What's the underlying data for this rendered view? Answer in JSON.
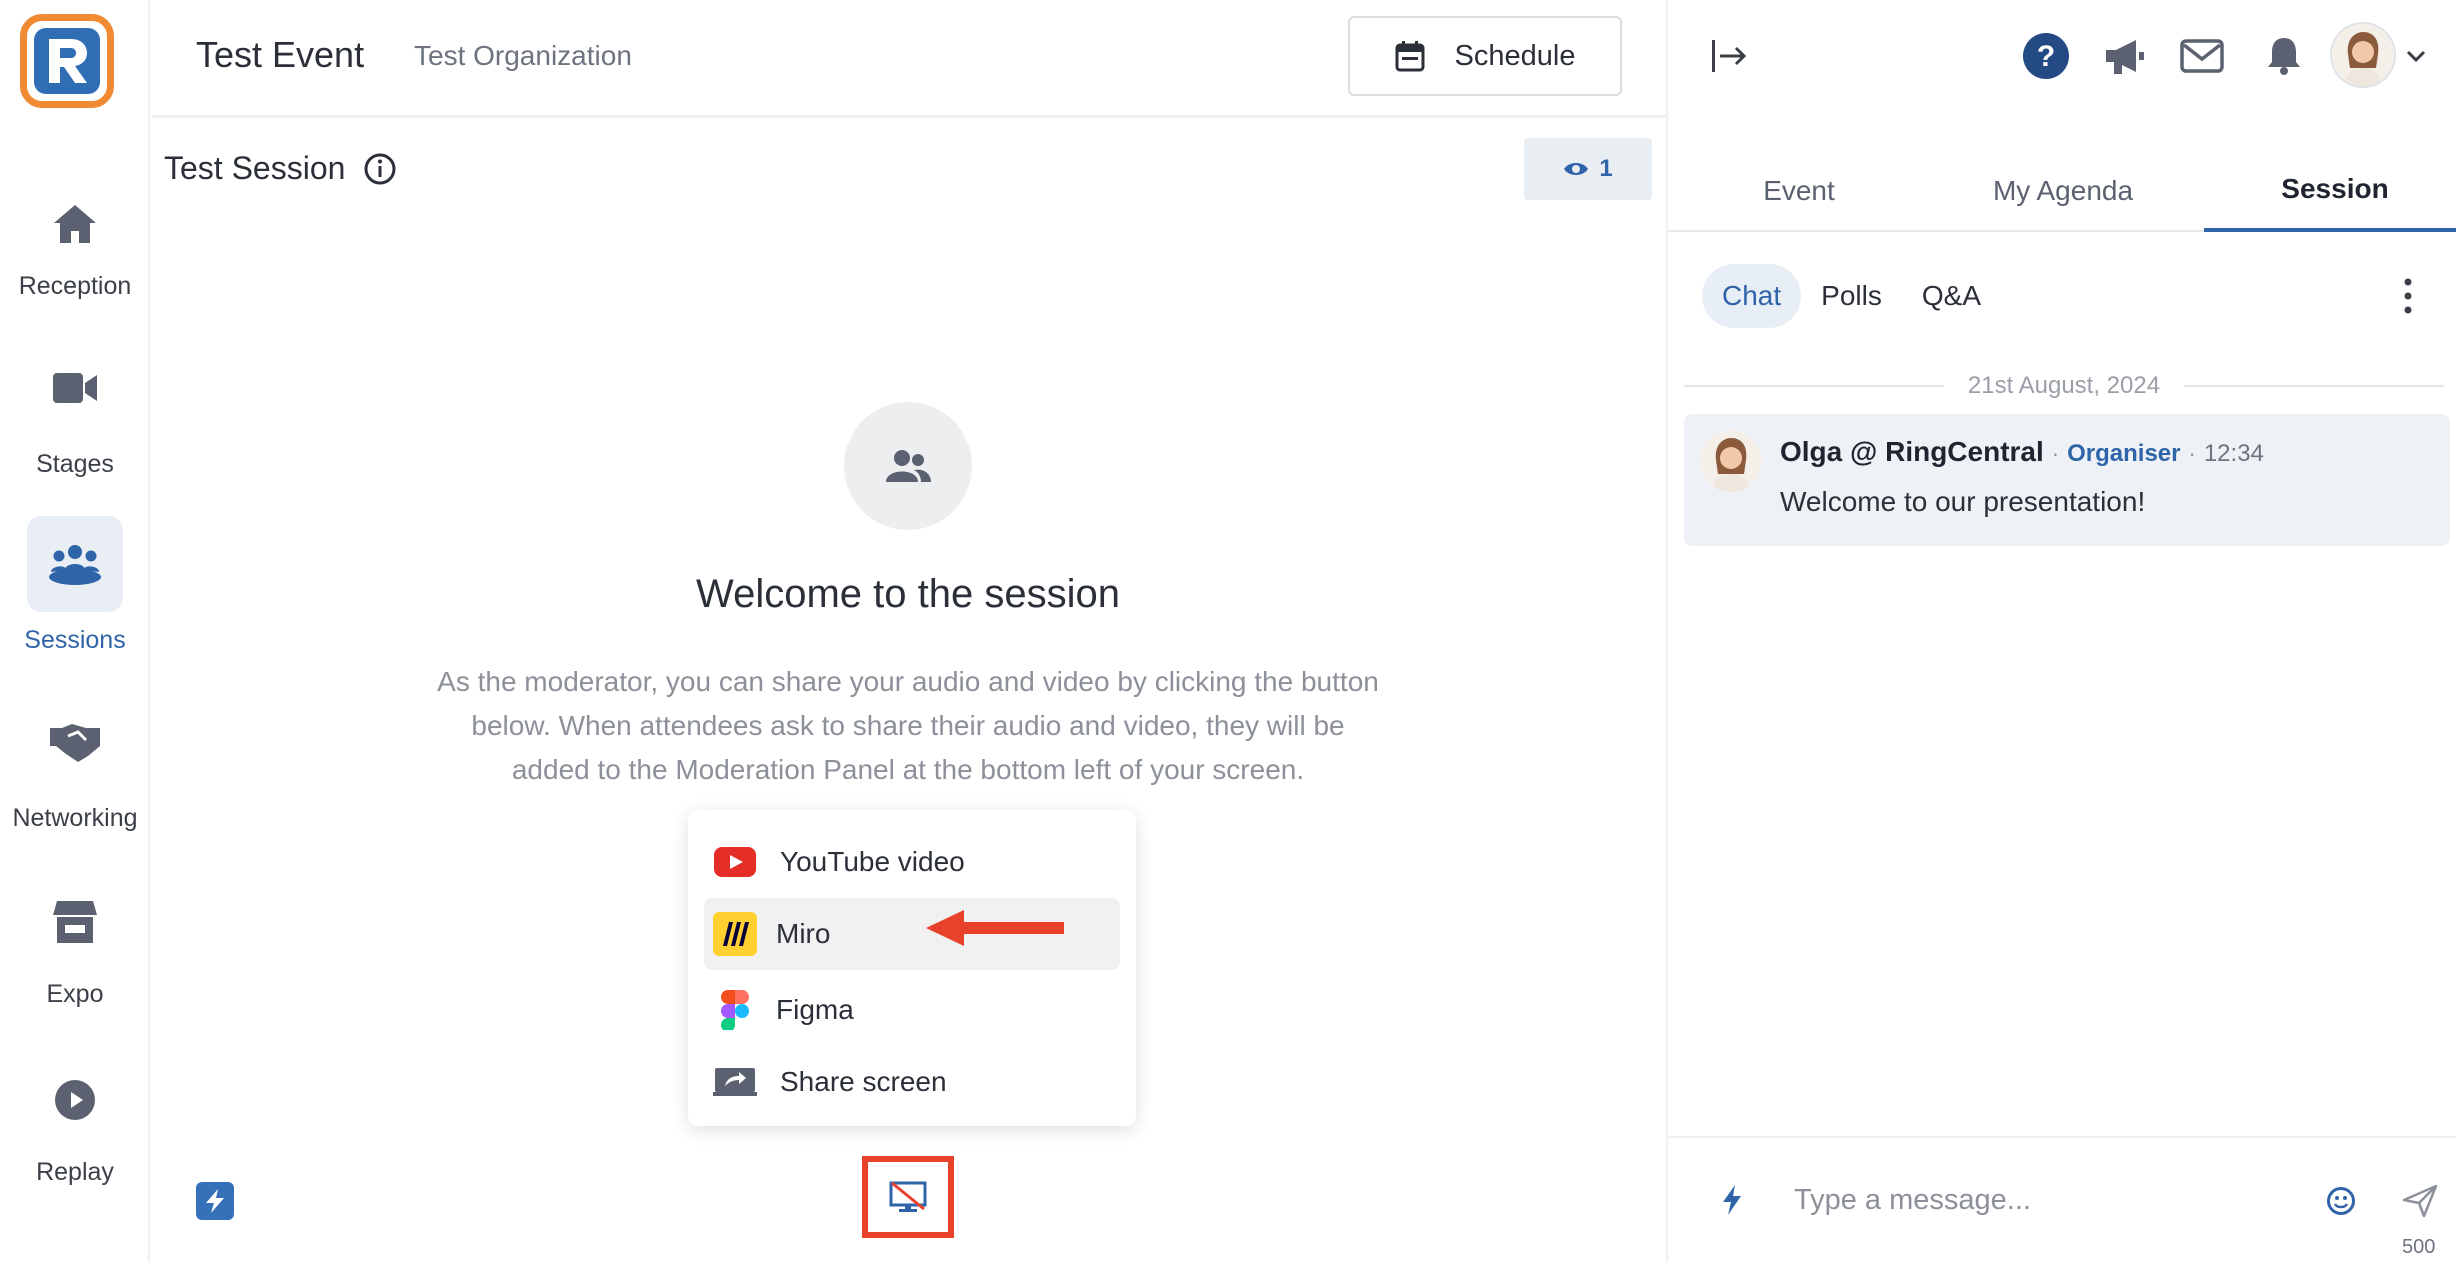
{
  "brand": {
    "logo_letter": "R",
    "accent": "#2f65a8",
    "logo_border": "#f08a33"
  },
  "nav": {
    "items": [
      {
        "label": "Reception",
        "icon": "home-icon",
        "active": false
      },
      {
        "label": "Stages",
        "icon": "video-camera-icon",
        "active": false
      },
      {
        "label": "Sessions",
        "icon": "people-group-icon",
        "active": true
      },
      {
        "label": "Networking",
        "icon": "handshake-icon",
        "active": false
      },
      {
        "label": "Expo",
        "icon": "store-icon",
        "active": false
      },
      {
        "label": "Replay",
        "icon": "play-circle-icon",
        "active": false
      }
    ]
  },
  "header": {
    "event_title": "Test Event",
    "organization": "Test Organization",
    "schedule_label": "Schedule"
  },
  "session": {
    "title": "Test Session",
    "viewer_count": "1"
  },
  "welcome": {
    "heading": "Welcome to the session",
    "body": "As the moderator, you can share your audio and video by clicking the button below. When attendees ask to share their audio and video, they will be added to the Moderation Panel at the bottom left of your screen."
  },
  "share_menu": {
    "items": [
      {
        "label": "YouTube video",
        "icon": "youtube-icon"
      },
      {
        "label": "Miro",
        "icon": "miro-icon",
        "highlighted": true
      },
      {
        "label": "Figma",
        "icon": "figma-icon"
      },
      {
        "label": "Share screen",
        "icon": "share-screen-icon"
      }
    ]
  },
  "right_panel": {
    "tabs": [
      {
        "label": "Event",
        "active": false
      },
      {
        "label": "My Agenda",
        "active": false
      },
      {
        "label": "Session",
        "active": true
      }
    ],
    "subtabs": [
      {
        "label": "Chat",
        "active": true
      },
      {
        "label": "Polls",
        "active": false
      },
      {
        "label": "Q&A",
        "active": false
      }
    ],
    "date_separator": "21st August, 2024",
    "message": {
      "author": "Olga @ RingCentral",
      "role": "Organiser",
      "time": "12:34",
      "text": "Welcome to our presentation!"
    },
    "composer": {
      "placeholder": "Type a message...",
      "char_count": "500"
    }
  },
  "annotations": {
    "highlight_color": "#e8422c"
  }
}
